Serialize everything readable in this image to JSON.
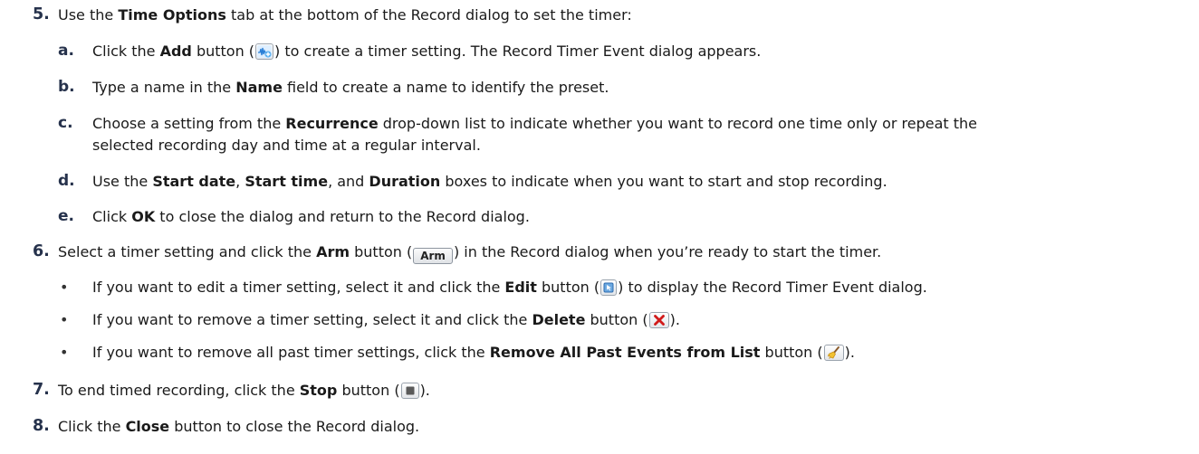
{
  "step5": {
    "number": "5.",
    "t1": "Use the ",
    "b1": "Time Options",
    "t2": " tab at the bottom of the Record dialog to set the timer:",
    "a": {
      "letter": "a.",
      "t1": "Click the ",
      "b1": "Add",
      "t2": " button (",
      "t3": ") to create a timer setting. The Record Timer Event dialog appears.",
      "icon": "add-waveform-icon"
    },
    "b": {
      "letter": "b.",
      "t1": "Type a name in the ",
      "b1": "Name",
      "t2": " field to create a name to identify the preset."
    },
    "c": {
      "letter": "c.",
      "t1": "Choose a setting from the ",
      "b1": "Recurrence",
      "t2": " drop-down list to indicate whether you want to record one time only or repeat the",
      "line2": "selected recording day and time at a regular interval."
    },
    "d": {
      "letter": "d.",
      "t1": "Use the ",
      "b1": "Start date",
      "t2": ", ",
      "b2": "Start time",
      "t3": ", and ",
      "b3": "Duration",
      "t4": " boxes to indicate when you want to start and stop recording."
    },
    "e": {
      "letter": "e.",
      "t1": "Click ",
      "b1": "OK",
      "t2": " to close the dialog and return to the Record dialog."
    }
  },
  "step6": {
    "number": "6.",
    "t1": "Select a timer setting and click the ",
    "b1": "Arm",
    "t2": " button (",
    "arm_label": "Arm",
    "t3": ") in the Record dialog when you’re ready to start the timer.",
    "bullets": [
      {
        "t1": "If you want to edit a timer setting, select it and click the ",
        "b1": "Edit",
        "t2": " button (",
        "t3": ") to display the Record Timer Event dialog.",
        "icon": "edit-icon"
      },
      {
        "t1": "If you want to remove a timer setting, select it and click the ",
        "b1": "Delete",
        "t2": " button (",
        "t3": ").",
        "icon": "delete-x-icon"
      },
      {
        "t1": "If you want to remove all past timer settings, click the ",
        "b1": "Remove All Past Events from List",
        "t2": " button (",
        "t3": ").",
        "icon": "broom-icon"
      }
    ]
  },
  "step7": {
    "number": "7.",
    "t1": "To end timed recording, click the ",
    "b1": "Stop",
    "t2": " button (",
    "t3": ").",
    "icon": "stop-icon"
  },
  "step8": {
    "number": "8.",
    "t1": "Click the ",
    "b1": "Close",
    "t2": " button to close the Record dialog."
  },
  "colors": {
    "number": "#26324c",
    "text": "#1a1a1a",
    "delete_red": "#d11a1a"
  }
}
